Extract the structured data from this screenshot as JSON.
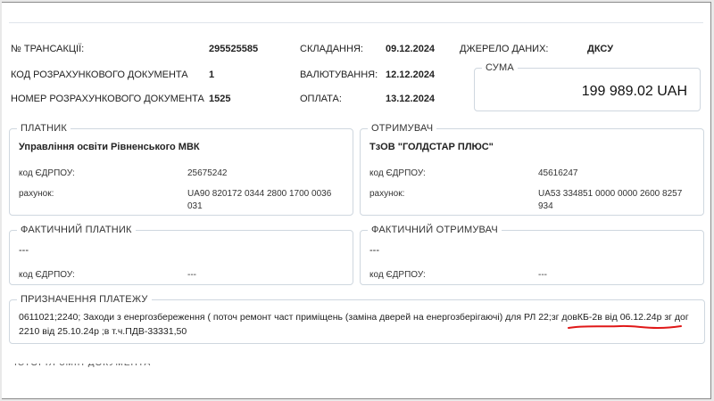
{
  "transaction": {
    "txn_no_label": "№ ТРАНСАКЦІЇ:",
    "txn_no_value": "295525585",
    "doc_code_label": "КОД РОЗРАХУНКОВОГО ДОКУМЕНТА",
    "doc_code_value": "1",
    "doc_number_label": "НОМЕР РОЗРАХУНКОВОГО ДОКУМЕНТА",
    "doc_number_value": "1525",
    "created_label": "СКЛАДАННЯ:",
    "created_value": "09.12.2024",
    "valuation_label": "ВАЛЮТУВАННЯ:",
    "valuation_value": "12.12.2024",
    "payment_label": "ОПЛАТА:",
    "payment_value": "13.12.2024",
    "source_label": "ДЖЕРЕЛО ДАНИХ:",
    "source_value": "ДКСУ"
  },
  "sum": {
    "title": "СУМА",
    "value": "199 989.02 UAH"
  },
  "payer": {
    "title": "ПЛАТНИК",
    "name": "Управління освіти Рівненського МВК",
    "edrpou_label": "код ЄДРПОУ:",
    "edrpou_value": "25675242",
    "account_label": "рахунок:",
    "account_line1": "UA90 820172 0344 2800 1700 0036",
    "account_line2": "031"
  },
  "recipient": {
    "title": "ОТРИМУВАЧ",
    "name": "ТзОВ \"ГОЛДСТАР ПЛЮС\"",
    "edrpou_label": "код ЄДРПОУ:",
    "edrpou_value": "45616247",
    "account_label": "рахунок:",
    "account_line1": "UA53 334851 0000 0000 2600 8257",
    "account_line2": "934"
  },
  "actual_payer": {
    "title": "ФАКТИЧНИЙ ПЛАТНИК",
    "name": "---",
    "edrpou_label": "код ЄДРПОУ:",
    "edrpou_value": "---"
  },
  "actual_recipient": {
    "title": "ФАКТИЧНИЙ ОТРИМУВАЧ",
    "name": "---",
    "edrpou_label": "код ЄДРПОУ:",
    "edrpou_value": "---"
  },
  "purpose": {
    "title": "ПРИЗНАЧЕННЯ ПЛАТЕЖУ",
    "text": "0611021;2240; Заходи з енергозбереження ( поточ ремонт част приміщень (заміна дверей на енергозберігаючі) для РЛ 22;зг довКБ-2в від 06.12.24р зг дог 2210 від 25.10.24р ;в т.ч.ПДВ-33331,50"
  },
  "annotation": {
    "underline_color": "#e01818"
  }
}
